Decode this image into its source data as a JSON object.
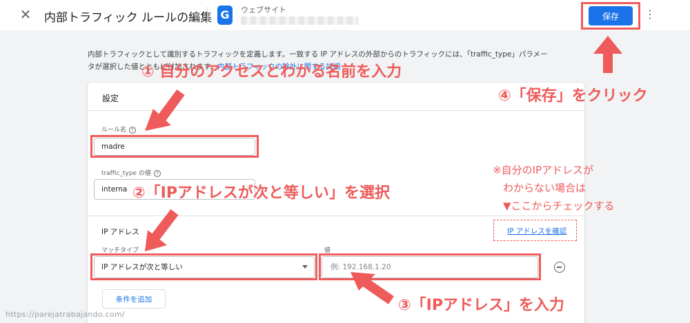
{
  "header": {
    "close_glyph": "✕",
    "title": "内部トラフィック ルールの編集",
    "logo_glyph": "G",
    "property_label": "ウェブサイト",
    "save_label": "保存",
    "menu_glyph": "⋮"
  },
  "description": {
    "line1": "内部トラフィックとして識別するトラフィックを定義します。一致する IP アドレスの外部からのトラフィックには、「traffic_type」パラメー",
    "line2_start": "タが選択した値とともに付加されます。",
    "link": "内部トラフィックの除外に関する詳細"
  },
  "card": {
    "title": "設定",
    "rule_name_label": "ルール名",
    "rule_name_value": "madre",
    "traffic_type_label": "traffic_type の値",
    "traffic_type_value": "interna",
    "ip_section_label": "IP アドレス",
    "match_type_label": "マッチタイプ",
    "match_type_value": "IP アドレスが次と等しい",
    "value_label": "値",
    "value_placeholder": "例: 192.168.1.20",
    "add_condition_label": "条件を追加",
    "check_ip_link": "IP アドレスを確認"
  },
  "annotations": {
    "step1": "① 自分のアクセスとわかる名前を入力",
    "step2": "②「IPアドレスが次と等しい」を選択",
    "step3": "③「IPアドレス」を入力",
    "step4": "④「保存」をクリック",
    "note_line1": "※自分のIPアドレスが",
    "note_line2": "　わからない場合は",
    "note_line3": "　▼ここからチェックする",
    "color": "#ef5a5a"
  },
  "watermark": "https://parejatrabajando.com/",
  "colors": {
    "accent": "#1a73e8",
    "annotation": "#ef5a5a",
    "background": "#f1f3f4"
  }
}
